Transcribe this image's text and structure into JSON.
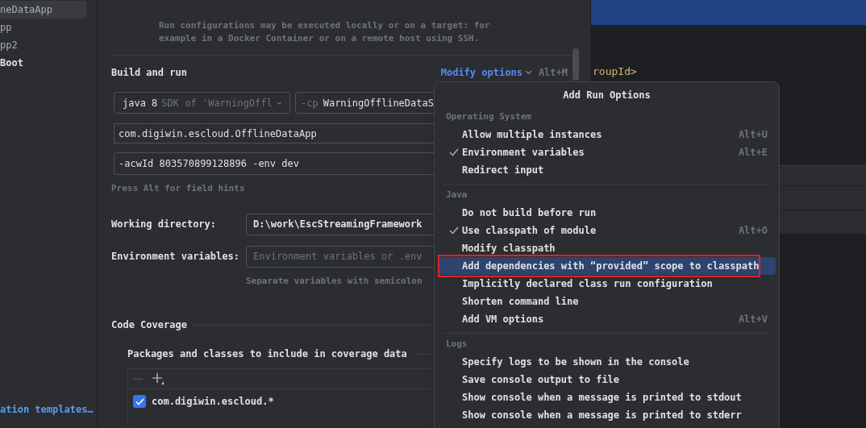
{
  "sidebar": {
    "items": [
      {
        "label": "neDataApp",
        "selected": true,
        "bold": false
      },
      {
        "label": "pp",
        "selected": false,
        "bold": false
      },
      {
        "label": "pp2",
        "selected": false,
        "bold": false
      },
      {
        "label": "Boot",
        "selected": false,
        "bold": true
      }
    ],
    "footer_link": "ation templates…"
  },
  "run_on": {
    "description": [
      "Run configurations may be executed locally or on a target: for",
      "example in a Docker Container or on a remote host using SSH."
    ]
  },
  "build_and_run": {
    "title": "Build and run",
    "modify_options": {
      "label": "Modify options",
      "shortcut": "Alt+M"
    },
    "sdk": {
      "value": "java 8",
      "hint": "SDK of 'WarningOffl"
    },
    "classpath": {
      "prefix": "-cp",
      "value": "WarningOfflineDataS"
    },
    "main_class": "com.digiwin.escloud.OfflineDataApp",
    "program_arguments": "-acwId 803570899128896 -env dev",
    "hint": "Press Alt for field hints"
  },
  "working_directory": {
    "label": "Working directory:",
    "value": "D:\\work\\EscStreamingFramework"
  },
  "environment_variables": {
    "label": "Environment variables:",
    "placeholder": "Environment variables or .env",
    "hint": "Separate variables with semicolon"
  },
  "code_coverage": {
    "title": "Code Coverage",
    "packages_title": "Packages and classes to include in coverage data",
    "packages": [
      {
        "label": "com.digiwin.escloud.*",
        "checked": true
      }
    ]
  },
  "editor": {
    "line": "roupId>"
  },
  "popup": {
    "title": "Add Run Options",
    "sections": [
      {
        "title": "Operating System",
        "items": [
          {
            "label": "Allow multiple instances",
            "shortcut": "Alt+U",
            "checked": false,
            "selected": false
          },
          {
            "label": "Environment variables",
            "shortcut": "Alt+E",
            "checked": true,
            "selected": false
          },
          {
            "label": "Redirect input",
            "checked": false,
            "selected": false
          }
        ]
      },
      {
        "title": "Java",
        "items": [
          {
            "label": "Do not build before run",
            "checked": false,
            "selected": false
          },
          {
            "label": "Use classpath of module",
            "shortcut": "Alt+O",
            "checked": true,
            "selected": false
          },
          {
            "label": "Modify classpath",
            "checked": false,
            "selected": false
          },
          {
            "label": "Add dependencies with “provided” scope to classpath",
            "checked": false,
            "selected": true
          },
          {
            "label": "Implicitly declared class run configuration",
            "checked": false,
            "selected": false
          },
          {
            "label": "Shorten command line",
            "checked": false,
            "selected": false
          },
          {
            "label": "Add VM options",
            "shortcut": "Alt+V",
            "checked": false,
            "selected": false
          }
        ]
      },
      {
        "title": "Logs",
        "items": [
          {
            "label": "Specify logs to be shown in the console",
            "checked": false,
            "selected": false
          },
          {
            "label": "Save console output to file",
            "checked": false,
            "selected": false
          },
          {
            "label": "Show console when a message is printed to stdout",
            "checked": false,
            "selected": false
          },
          {
            "label": "Show console when a message is printed to stderr",
            "checked": false,
            "selected": false
          }
        ]
      }
    ]
  }
}
